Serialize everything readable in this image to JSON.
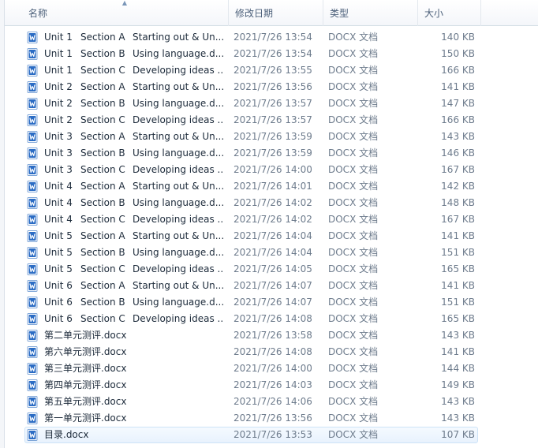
{
  "columns": {
    "name": "名称",
    "date": "修改日期",
    "type": "类型",
    "size": "大小"
  },
  "sort_glyph": "▲",
  "files": [
    {
      "unit": "Unit 1",
      "section": "Section A",
      "title": "Starting out & Un...",
      "date": "2021/7/26 13:54",
      "type": "DOCX 文档",
      "size": "140 KB"
    },
    {
      "unit": "Unit 1",
      "section": "Section B",
      "title": "Using language.d...",
      "date": "2021/7/26 13:54",
      "type": "DOCX 文档",
      "size": "150 KB"
    },
    {
      "unit": "Unit 1",
      "section": "Section C",
      "title": "Developing ideas ...",
      "date": "2021/7/26 13:55",
      "type": "DOCX 文档",
      "size": "166 KB"
    },
    {
      "unit": "Unit 2",
      "section": "Section A",
      "title": "Starting out & Un...",
      "date": "2021/7/26 13:56",
      "type": "DOCX 文档",
      "size": "141 KB"
    },
    {
      "unit": "Unit 2",
      "section": "Section B",
      "title": "Using language.d...",
      "date": "2021/7/26 13:57",
      "type": "DOCX 文档",
      "size": "147 KB"
    },
    {
      "unit": "Unit 2",
      "section": "Section C",
      "title": "Developing ideas ...",
      "date": "2021/7/26 13:57",
      "type": "DOCX 文档",
      "size": "166 KB"
    },
    {
      "unit": "Unit 3",
      "section": "Section A",
      "title": "Starting out & Un...",
      "date": "2021/7/26 13:59",
      "type": "DOCX 文档",
      "size": "143 KB"
    },
    {
      "unit": "Unit 3",
      "section": "Section B",
      "title": "Using language.d...",
      "date": "2021/7/26 13:59",
      "type": "DOCX 文档",
      "size": "146 KB"
    },
    {
      "unit": "Unit 3",
      "section": "Section C",
      "title": "Developing ideas ...",
      "date": "2021/7/26 14:00",
      "type": "DOCX 文档",
      "size": "167 KB"
    },
    {
      "unit": "Unit 4",
      "section": "Section A",
      "title": "Starting out & Un...",
      "date": "2021/7/26 14:01",
      "type": "DOCX 文档",
      "size": "142 KB"
    },
    {
      "unit": "Unit 4",
      "section": "Section B",
      "title": "Using language.d...",
      "date": "2021/7/26 14:02",
      "type": "DOCX 文档",
      "size": "148 KB"
    },
    {
      "unit": "Unit 4",
      "section": "Section C",
      "title": "Developing ideas ...",
      "date": "2021/7/26 14:02",
      "type": "DOCX 文档",
      "size": "167 KB"
    },
    {
      "unit": "Unit 5",
      "section": "Section A",
      "title": "Starting out & Un...",
      "date": "2021/7/26 14:04",
      "type": "DOCX 文档",
      "size": "141 KB"
    },
    {
      "unit": "Unit 5",
      "section": "Section B",
      "title": "Using language.d...",
      "date": "2021/7/26 14:04",
      "type": "DOCX 文档",
      "size": "151 KB"
    },
    {
      "unit": "Unit 5",
      "section": "Section C",
      "title": "Developing ideas ...",
      "date": "2021/7/26 14:05",
      "type": "DOCX 文档",
      "size": "165 KB"
    },
    {
      "unit": "Unit 6",
      "section": "Section A",
      "title": "Starting out & Un...",
      "date": "2021/7/26 14:07",
      "type": "DOCX 文档",
      "size": "141 KB"
    },
    {
      "unit": "Unit 6",
      "section": "Section B",
      "title": "Using language.d...",
      "date": "2021/7/26 14:07",
      "type": "DOCX 文档",
      "size": "151 KB"
    },
    {
      "unit": "Unit 6",
      "section": "Section C",
      "title": "Developing ideas ...",
      "date": "2021/7/26 14:08",
      "type": "DOCX 文档",
      "size": "165 KB"
    },
    {
      "unit": "",
      "section": "",
      "title": "第二单元测评.docx",
      "date": "2021/7/26 13:58",
      "type": "DOCX 文档",
      "size": "143 KB"
    },
    {
      "unit": "",
      "section": "",
      "title": "第六单元测评.docx",
      "date": "2021/7/26 14:08",
      "type": "DOCX 文档",
      "size": "141 KB"
    },
    {
      "unit": "",
      "section": "",
      "title": "第三单元测评.docx",
      "date": "2021/7/26 14:00",
      "type": "DOCX 文档",
      "size": "144 KB"
    },
    {
      "unit": "",
      "section": "",
      "title": "第四单元测评.docx",
      "date": "2021/7/26 14:03",
      "type": "DOCX 文档",
      "size": "149 KB"
    },
    {
      "unit": "",
      "section": "",
      "title": "第五单元测评.docx",
      "date": "2021/7/26 14:06",
      "type": "DOCX 文档",
      "size": "143 KB"
    },
    {
      "unit": "",
      "section": "",
      "title": "第一单元测评.docx",
      "date": "2021/7/26 13:56",
      "type": "DOCX 文档",
      "size": "143 KB"
    },
    {
      "unit": "",
      "section": "",
      "title": "目录.docx",
      "date": "2021/7/26 13:53",
      "type": "DOCX 文档",
      "size": "107 KB",
      "selected": true
    }
  ],
  "icon": {
    "name": "word-document-icon",
    "accent": "#2b6cc4"
  }
}
